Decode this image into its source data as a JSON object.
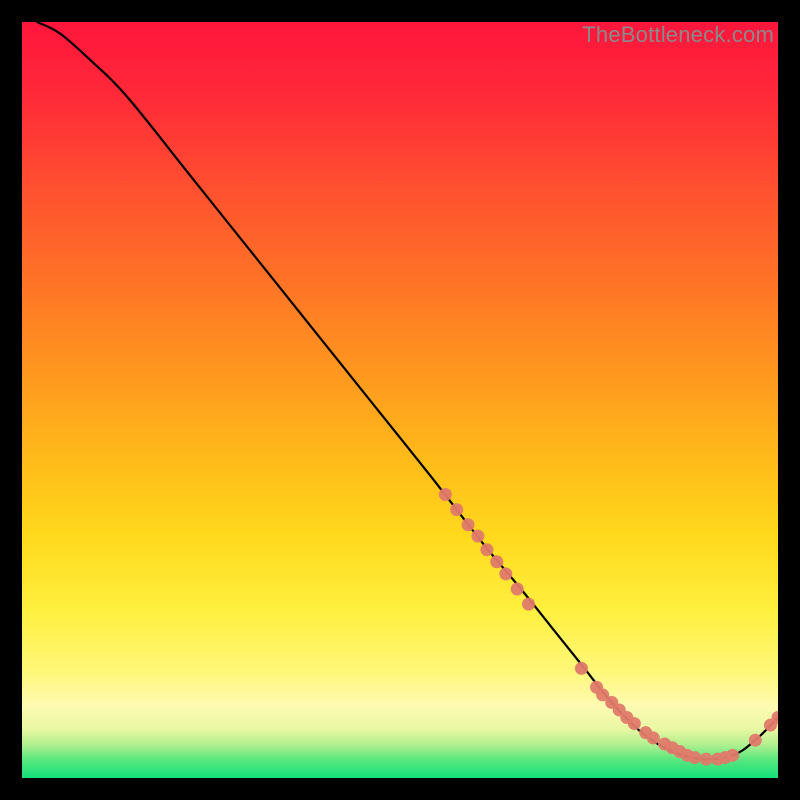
{
  "watermark": "TheBottleneck.com",
  "chart_data": {
    "type": "line",
    "title": "",
    "xlabel": "",
    "ylabel": "",
    "xlim": [
      0,
      100
    ],
    "ylim": [
      0,
      100
    ],
    "grid": false,
    "legend": false,
    "background_gradient": {
      "top_color": "#ff1a3a",
      "mid_colors": [
        "#ff7a2a",
        "#ffd21a",
        "#fff275"
      ],
      "bottom_color": "#17e67a"
    },
    "series": [
      {
        "name": "curve",
        "type": "line",
        "color": "#000000",
        "x": [
          2,
          5,
          9,
          14,
          22,
          30,
          38,
          46,
          54,
          61,
          66,
          70,
          74,
          78,
          82,
          86,
          90,
          94,
          97,
          100
        ],
        "y": [
          100,
          98.5,
          95,
          90,
          80,
          70,
          60,
          50,
          40,
          31,
          25,
          20,
          15,
          10,
          6,
          3.5,
          2.5,
          3,
          5,
          8
        ]
      },
      {
        "name": "marker-cluster-left",
        "type": "scatter",
        "color": "#e07a6a",
        "x": [
          56,
          57.5,
          59,
          60.3,
          61.5,
          62.8,
          64,
          65.5,
          67
        ],
        "y": [
          37.5,
          35.5,
          33.5,
          32,
          30.2,
          28.6,
          27,
          25,
          23
        ]
      },
      {
        "name": "marker-cluster-bottom",
        "type": "scatter",
        "color": "#e07a6a",
        "x": [
          74,
          76,
          76.8,
          78,
          79,
          80,
          81,
          82.5,
          83.5,
          85,
          86,
          87,
          88,
          89,
          90.5,
          92,
          93,
          94,
          97,
          99,
          100
        ],
        "y": [
          14.5,
          12,
          11,
          10,
          9,
          8,
          7.2,
          6,
          5.3,
          4.5,
          4,
          3.5,
          3,
          2.7,
          2.5,
          2.5,
          2.7,
          3,
          5,
          7,
          8
        ]
      }
    ]
  }
}
